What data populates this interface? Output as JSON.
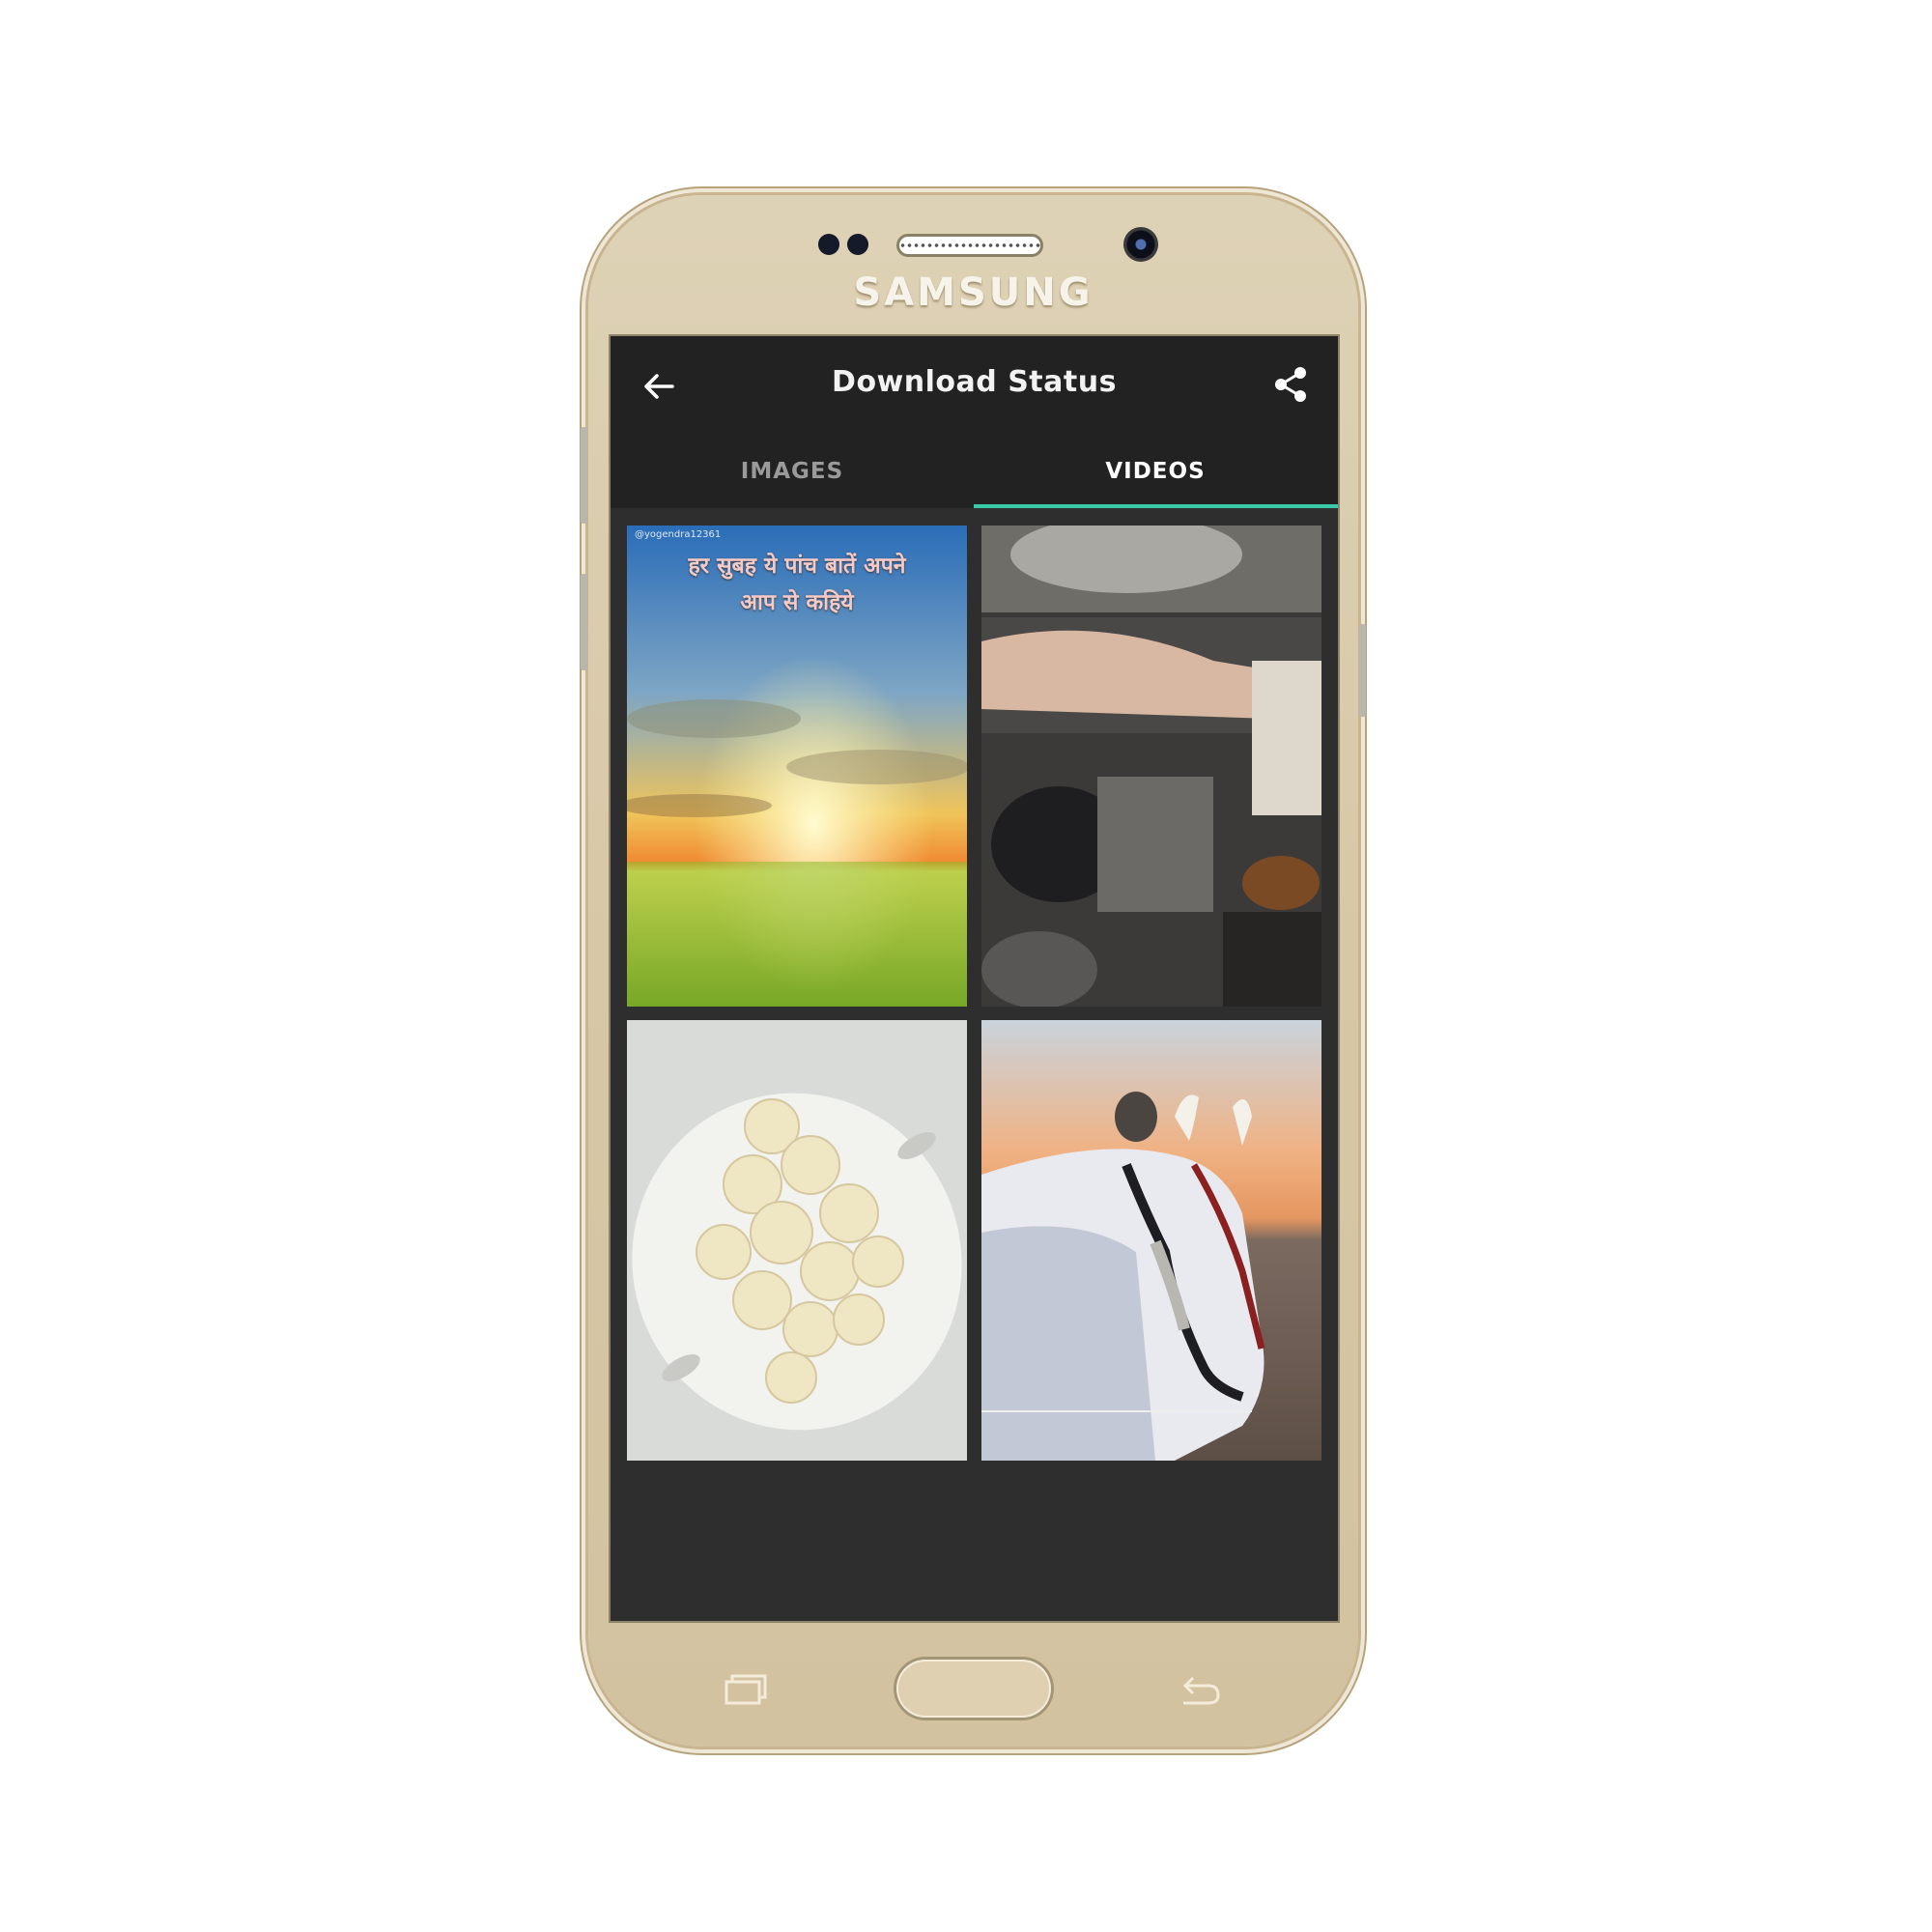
{
  "device": {
    "brand": "SAMSUNG"
  },
  "app": {
    "title": "Download Status",
    "back_icon": "arrow-back-icon",
    "share_icon": "share-icon",
    "accent_color": "#38c9a8",
    "background_color": "#2e2e2e",
    "toolbar_color": "#222222"
  },
  "tabs": [
    {
      "label": "IMAGES",
      "selected": false
    },
    {
      "label": "VIDEOS",
      "selected": true
    }
  ],
  "videos": [
    {
      "overlay_line1": "हर सुबह ये पांच बातें अपने",
      "overlay_line2": "आप से कहिये",
      "watermark": "@yogendra12361"
    },
    {
      "subject": "cooking"
    },
    {
      "subject": "food-plate"
    },
    {
      "subject": "horse"
    }
  ],
  "system_nav": {
    "recents_icon": "recents-icon",
    "home_icon": "home-button-icon",
    "back_icon": "back-key-icon"
  }
}
